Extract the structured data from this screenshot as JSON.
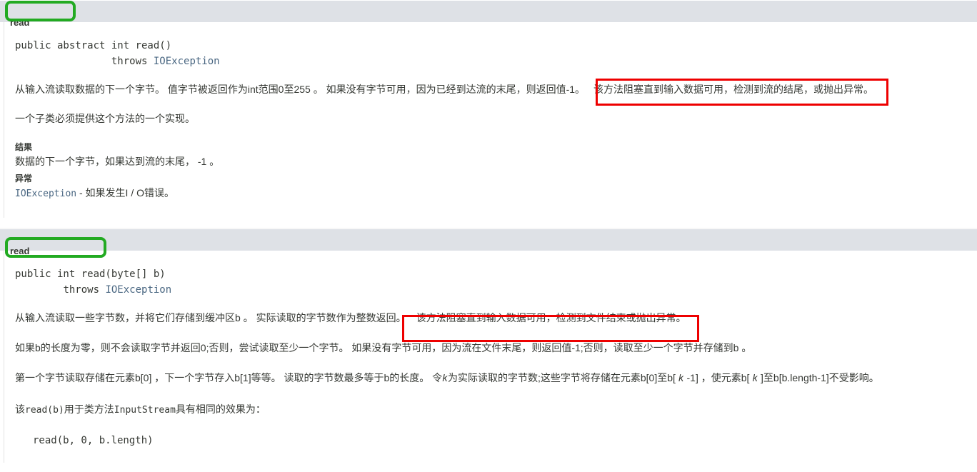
{
  "page": {
    "background": "#ffffff",
    "header_bar_color": "#dee1e6",
    "link_color": "#4a6782",
    "highlight_green": "#22aa22",
    "highlight_red": "#ee0000"
  },
  "sections": [
    {
      "anchor_label": "read",
      "signature_line1": "public abstract int read()",
      "signature_indent": "                ",
      "signature_throws_kw": "throws ",
      "signature_throws_type": "IOException",
      "paragraph1_before": "从输入流读取数据的下一个字节。 值字节被返回作为int范围0至255 。 如果没有字节可用，因为已经到达流的末尾，则返回值-1。",
      "paragraph1_highlight": "该方法阻塞直到输入数据可用，检测到流的结尾，或抛出异常。",
      "paragraph2": "一个子类必须提供这个方法的一个实现。",
      "result_heading": "结果",
      "result_text": "数据的下一个字节，如果达到流的末尾， -1 。",
      "throws_heading": "异常",
      "throws_type": "IOException",
      "throws_desc": " - 如果发生I / O错误。"
    },
    {
      "anchor_label": "read",
      "signature_line1": "public int read(byte[] b)",
      "signature_indent": "        ",
      "signature_throws_kw": "throws ",
      "signature_throws_type": "IOException",
      "paragraph1_before": "从输入流读取一些字节数，并将它们存储到缓冲区b 。 实际读取的字节数作为整数返回。",
      "paragraph1_highlight": "该方法阻塞直到输入数据可用，检测到文件结束或抛出异常。",
      "paragraph2": "如果b的长度为零，则不会读取字节并返回0;否则，尝试读取至少一个字节。 如果没有字节可用，因为流在文件末尾，则返回值-1;否则，读取至少一个字节并存储到b 。",
      "paragraph3_part1": "第一个字节读取存储在元素b[0] ，下一个字节存入b[1]等等。 读取的字节数最多等于b的长度。 令",
      "paragraph3_k1": "k",
      "paragraph3_part2": "为实际读取的字节数;这些字节将存储在元素b[0]至b[ ",
      "paragraph3_k2": "k",
      "paragraph3_part3": " -1] ，使元素b[ ",
      "paragraph3_k3": "k",
      "paragraph3_part4": " ]至b[b.length-1]不受影响。",
      "paragraph4_prefix": "该",
      "paragraph4_code1": "read(b)",
      "paragraph4_mid": "用于类方法",
      "paragraph4_code2": "InputStream",
      "paragraph4_suffix": "具有相同的效果为：",
      "code_block": "read(b, 0, b.length)"
    }
  ]
}
